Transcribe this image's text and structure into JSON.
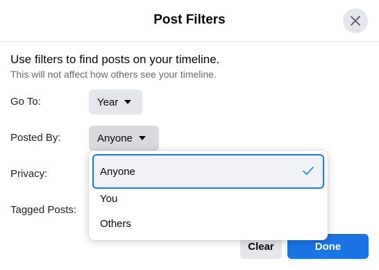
{
  "dialog": {
    "title": "Post Filters",
    "close_icon": "close-icon"
  },
  "intro": {
    "heading": "Use filters to find posts on your timeline.",
    "subheading": "This will not affect how others see your timeline."
  },
  "filters": {
    "go_to": {
      "label": "Go To:",
      "value": "Year"
    },
    "posted_by": {
      "label": "Posted By:",
      "value": "Anyone"
    },
    "privacy": {
      "label": "Privacy:"
    },
    "tagged_posts": {
      "label": "Tagged Posts:"
    }
  },
  "dropdown": {
    "options": [
      {
        "label": "Anyone",
        "selected": true
      },
      {
        "label": "You",
        "selected": false
      },
      {
        "label": "Others",
        "selected": false
      }
    ],
    "check_icon": "check-icon"
  },
  "footer": {
    "clear_label": "Clear",
    "done_label": "Done"
  },
  "colors": {
    "accent": "#1877f2",
    "done_button": "#1b74e4",
    "secondary_button": "#e4e6eb",
    "subtext": "#65676b"
  }
}
